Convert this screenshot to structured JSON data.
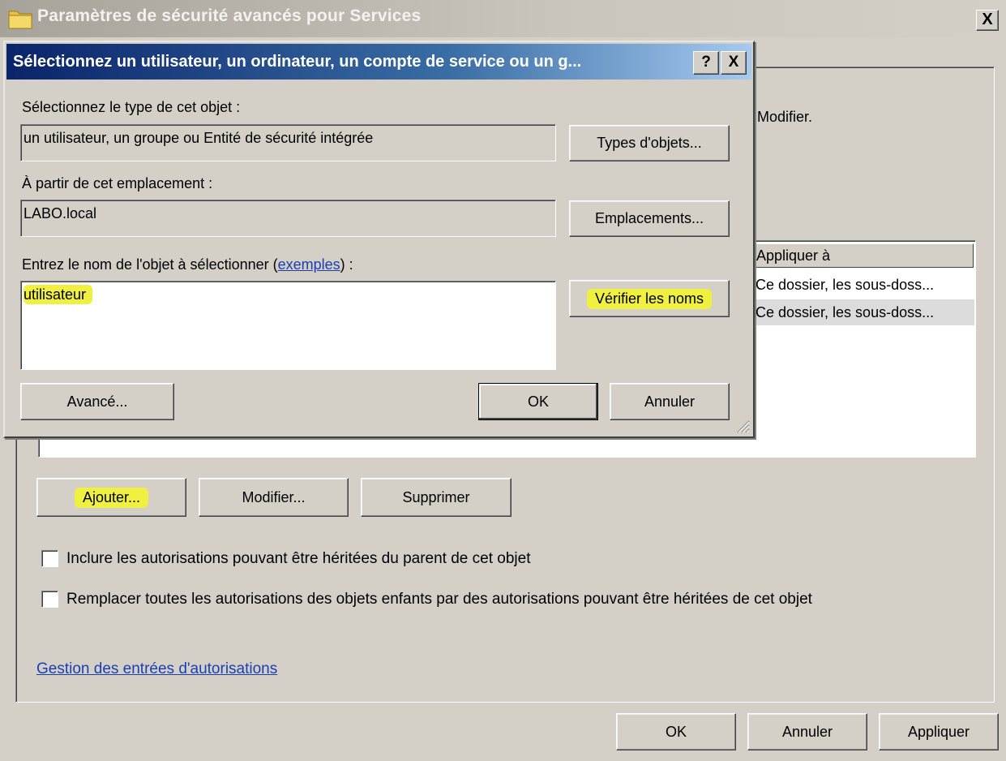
{
  "parent": {
    "title": "Paramètres de sécurité avancés pour Services",
    "close_label": "X",
    "hint_text": "Modifier.",
    "list_header": "Appliquer à",
    "list_rows": [
      {
        "apply_to": "Ce dossier, les sous-doss..."
      },
      {
        "apply_to": "Ce dossier, les sous-doss..."
      }
    ],
    "buttons": {
      "add": "Ajouter...",
      "edit": "Modifier...",
      "remove": "Supprimer"
    },
    "checkboxes": {
      "include_inherited": "Inclure les autorisations pouvant être héritées du parent de cet objet",
      "replace_children": "Remplacer toutes les autorisations des objets enfants par des autorisations pouvant être héritées de cet objet"
    },
    "manage_link": "Gestion des entrées d'autorisations",
    "footer": {
      "ok": "OK",
      "cancel": "Annuler",
      "apply": "Appliquer"
    }
  },
  "dialog": {
    "title": "Sélectionnez un utilisateur, un ordinateur, un compte de service ou un g...",
    "help_label": "?",
    "close_label": "X",
    "object_type_label": "Sélectionnez le type de cet objet :",
    "object_type_value": "un utilisateur, un groupe ou Entité de sécurité intégrée",
    "object_types_button": "Types d'objets...",
    "location_label": "À partir de cet emplacement :",
    "location_value": "LABO.local",
    "locations_button": "Emplacements...",
    "enter_name_label": "Entrez le nom de l'objet à sélectionner (",
    "examples_link": "exemples",
    "enter_name_suffix": ") :",
    "name_value": "utilisateur",
    "check_names_button": "Vérifier les noms",
    "advanced_button": "Avancé...",
    "ok_button": "OK",
    "cancel_button": "Annuler"
  },
  "colors": {
    "window_bg": "#d4d0c8",
    "active_title": "#0a246a",
    "highlight": "#f0f040",
    "link": "#1a3fb0"
  }
}
